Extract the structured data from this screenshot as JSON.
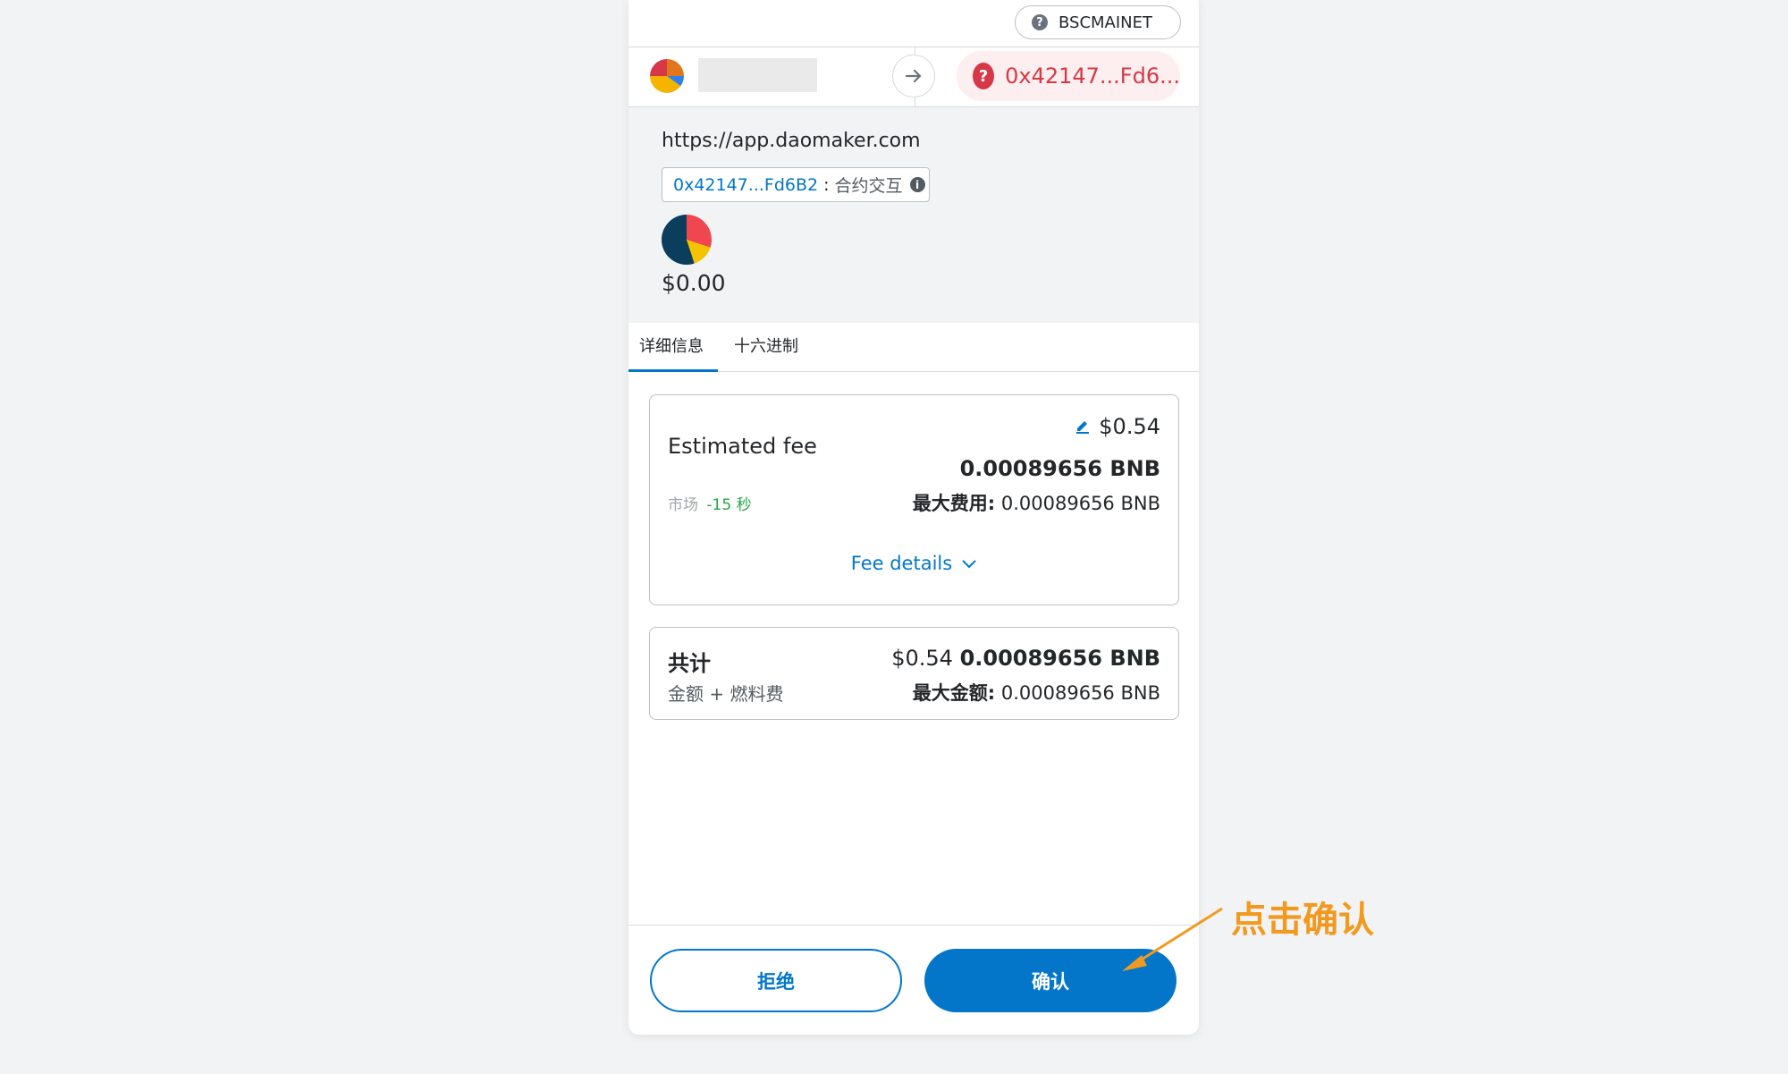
{
  "network": {
    "name": "BSCMAINET",
    "icon": "question-icon"
  },
  "header": {
    "from_account_name": "",
    "to_address": "0x42147...Fd6..."
  },
  "origin": {
    "url": "https://app.daomaker.com",
    "contract_address": "0x42147...Fd6B2",
    "contract_separator": ":",
    "contract_type": "合约交互",
    "value": "$0.00"
  },
  "tabs": [
    {
      "label": "详细信息",
      "active": true
    },
    {
      "label": "十六进制",
      "active": false
    }
  ],
  "fee": {
    "label": "Estimated fee",
    "usd": "$0.54",
    "bnb": "0.00089656 BNB",
    "market_label": "市场",
    "market_time": "-15 秒",
    "max_label": "最大费用:",
    "max_value": "0.00089656 BNB",
    "details_label": "Fee details"
  },
  "total": {
    "label": "共计",
    "sub": "金额 + 燃料费",
    "usd": "$0.54",
    "bnb": "0.00089656 BNB",
    "max_label": "最大金额:",
    "max_value": "0.00089656 BNB"
  },
  "buttons": {
    "reject": "拒绝",
    "confirm": "确认"
  },
  "annotation": {
    "text": "点击确认",
    "color": "#f29a1f"
  },
  "colors": {
    "accent": "#0376c9",
    "error": "#d73847",
    "success": "#28a745"
  }
}
